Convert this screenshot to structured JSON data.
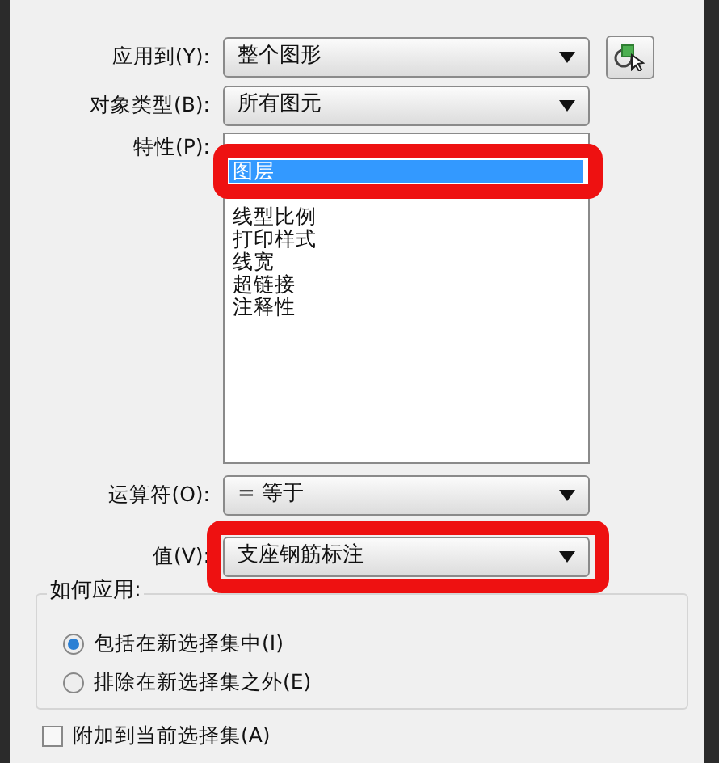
{
  "apply_to": {
    "label": "应用到(Y):",
    "value": "整个图形"
  },
  "object_type": {
    "label": "对象类型(B):",
    "value": "所有图元"
  },
  "properties": {
    "label": "特性(P):",
    "highlighted": true,
    "items": [
      {
        "text": "图层",
        "selected": true
      },
      {
        "text": "线型比例",
        "selected": false
      },
      {
        "text": "打印样式",
        "selected": false
      },
      {
        "text": "线宽",
        "selected": false
      },
      {
        "text": "超链接",
        "selected": false
      },
      {
        "text": "注释性",
        "selected": false
      }
    ]
  },
  "operator": {
    "label": "运算符(O):",
    "value": "= 等于"
  },
  "value": {
    "label": "值(V):",
    "value": "支座钢筋标注",
    "highlighted": true
  },
  "how_to_apply": {
    "title": "如何应用:",
    "options": [
      {
        "text": "包括在新选择集中(I)",
        "selected": true
      },
      {
        "text": "排除在新选择集之外(E)",
        "selected": false
      }
    ]
  },
  "append": {
    "text": "附加到当前选择集(A)",
    "checked": false
  }
}
